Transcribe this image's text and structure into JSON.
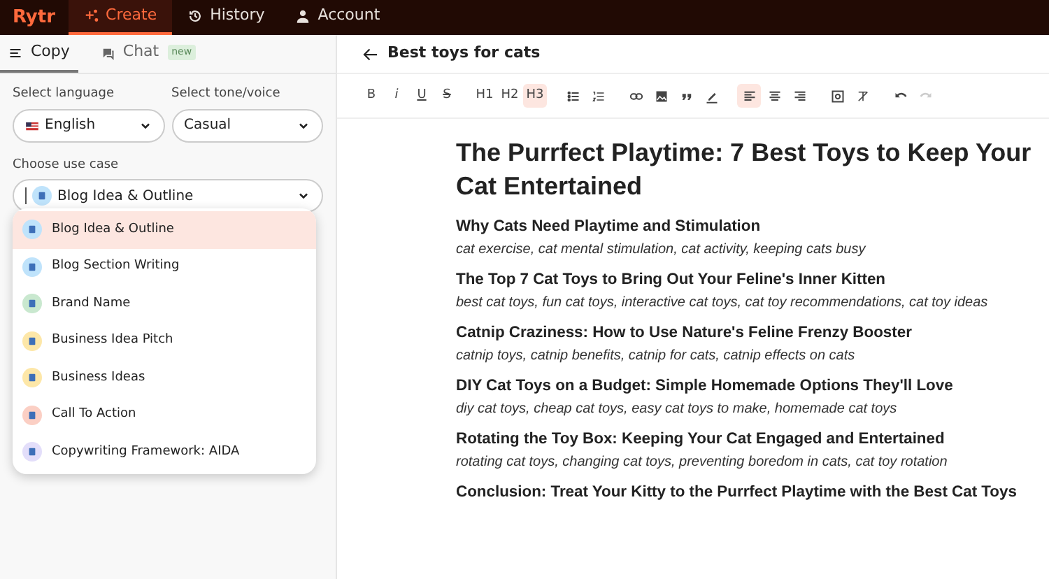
{
  "nav": {
    "logo": "Rytr",
    "tabs": [
      {
        "label": "Create",
        "selected": true
      },
      {
        "label": "History",
        "selected": false
      },
      {
        "label": "Account",
        "selected": false
      }
    ]
  },
  "sidebar": {
    "tabs": [
      {
        "label": "Copy",
        "selected": true
      },
      {
        "label": "Chat",
        "badge": "new",
        "selected": false
      }
    ],
    "language": {
      "label": "Select language",
      "value": "English"
    },
    "tone": {
      "label": "Select tone/voice",
      "value": "Casual"
    },
    "use_case": {
      "label": "Choose use case",
      "value": "Blog Idea & Outline",
      "color": "#bfe3fb"
    },
    "options": [
      {
        "label": "Blog Idea & Outline",
        "color": "#bfe3fb",
        "selected": true
      },
      {
        "label": "Blog Section Writing",
        "color": "#bfe3fb",
        "selected": false
      },
      {
        "label": "Brand Name",
        "color": "#c9e8cf",
        "selected": false
      },
      {
        "label": "Business Idea Pitch",
        "color": "#fde7a8",
        "selected": false
      },
      {
        "label": "Business Ideas",
        "color": "#fde7a8",
        "selected": false
      },
      {
        "label": "Call To Action",
        "color": "#fbcfc4",
        "selected": false
      },
      {
        "label": "Copywriting Framework: AIDA",
        "color": "#e3defa",
        "selected": false
      }
    ]
  },
  "editor": {
    "title": "Best toys for cats",
    "toolbar": [
      {
        "kind": "text",
        "label": "B",
        "active": false
      },
      {
        "kind": "text",
        "label": "i",
        "active": false
      },
      {
        "kind": "text",
        "label": "U",
        "active": false
      },
      {
        "kind": "text",
        "label": "S",
        "active": false
      },
      {
        "kind": "gap"
      },
      {
        "kind": "text",
        "label": "H1",
        "active": false
      },
      {
        "kind": "text",
        "label": "H2",
        "active": false
      },
      {
        "kind": "text",
        "label": "H3",
        "active": true
      },
      {
        "kind": "gap"
      },
      {
        "kind": "bullets",
        "active": false
      },
      {
        "kind": "numbers",
        "active": false
      },
      {
        "kind": "gap"
      },
      {
        "kind": "link",
        "active": false
      },
      {
        "kind": "image",
        "active": false
      },
      {
        "kind": "quote",
        "active": false
      },
      {
        "kind": "pen",
        "active": false
      },
      {
        "kind": "gap"
      },
      {
        "kind": "align-left",
        "active": true
      },
      {
        "kind": "align-center",
        "active": false
      },
      {
        "kind": "align-right",
        "active": false
      },
      {
        "kind": "gap"
      },
      {
        "kind": "media",
        "active": false
      },
      {
        "kind": "clear",
        "active": false
      },
      {
        "kind": "gap"
      },
      {
        "kind": "undo",
        "active": false
      },
      {
        "kind": "redo",
        "active": false,
        "disabled": true
      }
    ],
    "heading": "The Purrfect Playtime: 7 Best Toys to Keep Your Cat Entertained",
    "sections": [
      {
        "heading": "Why Cats Need Playtime and Stimulation",
        "keywords": "cat exercise, cat mental stimulation, cat activity, keeping cats busy"
      },
      {
        "heading": "The Top 7 Cat Toys to Bring Out Your Feline's Inner Kitten",
        "keywords": "best cat toys, fun cat toys, interactive cat toys, cat toy recommendations, cat toy ideas"
      },
      {
        "heading": "Catnip Craziness: How to Use Nature's Feline Frenzy Booster",
        "keywords": "catnip toys, catnip benefits, catnip for cats, catnip effects on cats"
      },
      {
        "heading": "DIY Cat Toys on a Budget: Simple Homemade Options They'll Love",
        "keywords": "diy cat toys, cheap cat toys, easy cat toys to make, homemade cat toys"
      },
      {
        "heading": "Rotating the Toy Box: Keeping Your Cat Engaged and Entertained",
        "keywords": "rotating cat toys, changing cat toys, preventing boredom in cats, cat toy rotation"
      },
      {
        "heading": "Conclusion: Treat Your Kitty to the Purrfect Playtime with the Best Cat Toys"
      }
    ]
  }
}
